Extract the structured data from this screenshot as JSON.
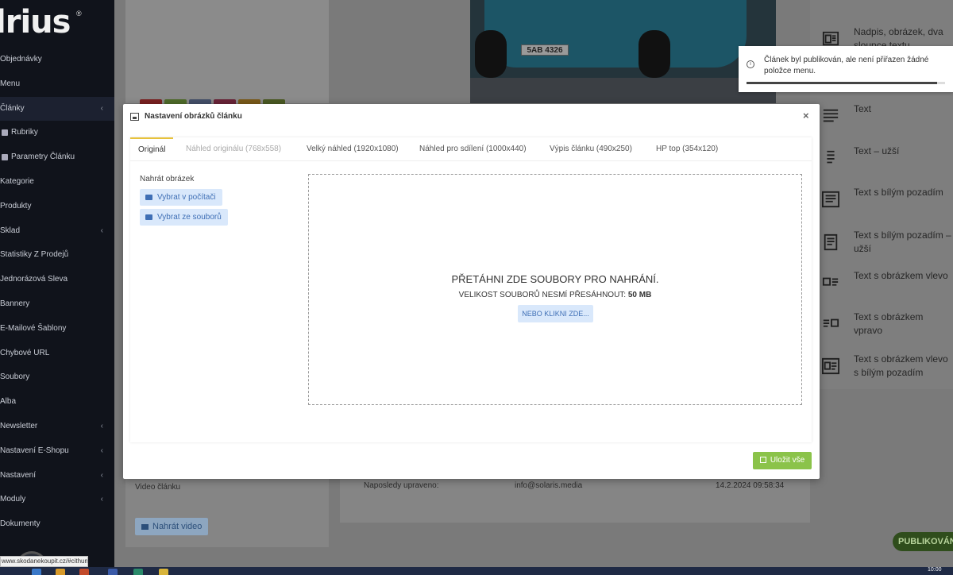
{
  "app": {
    "logo_text": "lrius",
    "logo_reg": "®"
  },
  "sidebar": {
    "items": [
      {
        "label": "Objednávky",
        "has_children": false,
        "active": false,
        "sub": false
      },
      {
        "label": "Menu",
        "has_children": false,
        "active": false,
        "sub": false
      },
      {
        "label": "Články",
        "has_children": true,
        "active": true,
        "sub": false
      },
      {
        "label": "Rubriky",
        "has_children": false,
        "active": false,
        "sub": true
      },
      {
        "label": "Parametry Článku",
        "has_children": false,
        "active": false,
        "sub": true
      },
      {
        "label": "Kategorie",
        "has_children": false,
        "active": false,
        "sub": false
      },
      {
        "label": "Produkty",
        "has_children": false,
        "active": false,
        "sub": false
      },
      {
        "label": "Sklad",
        "has_children": true,
        "active": false,
        "sub": false
      },
      {
        "label": "Statistiky Z Prodejů",
        "has_children": false,
        "active": false,
        "sub": false
      },
      {
        "label": "Jednorázová Sleva",
        "has_children": false,
        "active": false,
        "sub": false
      },
      {
        "label": "Bannery",
        "has_children": false,
        "active": false,
        "sub": false
      },
      {
        "label": "E-Mailové Šablony",
        "has_children": false,
        "active": false,
        "sub": false
      },
      {
        "label": "Chybové URL",
        "has_children": false,
        "active": false,
        "sub": false
      },
      {
        "label": "Soubory",
        "has_children": false,
        "active": false,
        "sub": false
      },
      {
        "label": "Alba",
        "has_children": false,
        "active": false,
        "sub": false
      },
      {
        "label": "Newsletter",
        "has_children": true,
        "active": false,
        "sub": false
      },
      {
        "label": "Nastavení E-Shopu",
        "has_children": true,
        "active": false,
        "sub": false
      },
      {
        "label": "Nastavení",
        "has_children": true,
        "active": false,
        "sub": false
      },
      {
        "label": "Moduly",
        "has_children": true,
        "active": false,
        "sub": false
      },
      {
        "label": "Dokumenty",
        "has_children": false,
        "active": false,
        "sub": false
      }
    ]
  },
  "background": {
    "swatch_colors": [
      "#7a2121",
      "#4f6b2a",
      "#45506a",
      "#6a2438",
      "#7a5a1a",
      "#4b5a23"
    ],
    "car_plate": "5AB 4326",
    "blocks": [
      {
        "label": "Nadpis, obrázek, dva sloupce textu",
        "icon": "heading-image-columns-icon"
      },
      {
        "label": "Text",
        "icon": "text-icon"
      },
      {
        "label": "Text – užší",
        "icon": "narrow-text-icon"
      },
      {
        "label": "Text s bílým pozadím",
        "icon": "text-white-bg-icon"
      },
      {
        "label": "Text s bílým pozadím – užší",
        "icon": "narrow-text-white-bg-icon"
      },
      {
        "label": "Text s obrázkem vlevo",
        "icon": "text-image-left-icon"
      },
      {
        "label": "Text s obrázkem vpravo",
        "icon": "text-image-right-icon"
      },
      {
        "label": "Text s obrázkem vlevo s bílým pozadím",
        "icon": "text-image-left-white-bg-icon"
      }
    ],
    "video_label": "Video článku",
    "upload_video_label": "Nahrát video",
    "last_modified_label": "Naposledy upraveno:",
    "last_modified_by": "info@solaris.media",
    "last_modified_at": "14.2.2024 09:58:34",
    "publish_label": "PUBLIKOVÁNO"
  },
  "toast": {
    "message": "Článek byl publikován, ale není přiřazen žádné položce menu.",
    "icon": "info-icon",
    "progress_percent": 96
  },
  "modal": {
    "title": "Nastavení obrázků článku",
    "close_label": "×",
    "tabs": [
      {
        "label": "Originál",
        "active": true,
        "dim": false
      },
      {
        "label": "Náhled originálu (768x558)",
        "active": false,
        "dim": true
      },
      {
        "label": "Velký náhled (1920x1080)",
        "active": false,
        "dim": false
      },
      {
        "label": "Náhled pro sdílení (1000x440)",
        "active": false,
        "dim": false
      },
      {
        "label": "Výpis článku (490x250)",
        "active": false,
        "dim": false
      },
      {
        "label": "HP top (354x120)",
        "active": false,
        "dim": false
      }
    ],
    "upload_label": "Nahrát obrázek",
    "from_computer_label": "Vybrat v počítači",
    "from_files_label": "Vybrat ze souborů",
    "dropzone": {
      "title": "PŘETÁHNI ZDE SOUBORY PRO NAHRÁNÍ.",
      "size_prefix": "VELIKOST SOUBORŮ NESMÍ PŘESÁHNOUT:",
      "size_value": "50 MB",
      "click_label": "NEBO KLIKNI ZDE..."
    },
    "save_all_label": "Uložit vše"
  },
  "status_url": "www.skodanekoupit.cz/#cithumb",
  "taskbar": {
    "time": "10:00"
  }
}
